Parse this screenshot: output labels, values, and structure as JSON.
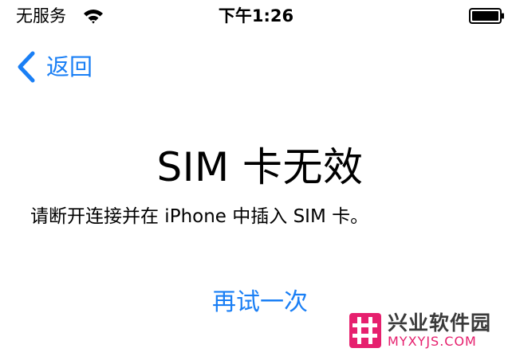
{
  "status_bar": {
    "carrier": "无服务",
    "time": "下午1:26",
    "wifi_icon": "wifi-icon",
    "battery_icon": "battery-full-icon"
  },
  "nav": {
    "back_label": "返回",
    "back_icon": "chevron-left-icon"
  },
  "content": {
    "title": "SIM 卡无效",
    "instruction": "请断开连接并在 iPhone 中插入 SIM 卡。",
    "retry_label": "再试一次"
  },
  "watermark": {
    "name": "兴业软件园",
    "url": "MYXYJS.COM",
    "icon": "hash-logo-icon"
  },
  "colors": {
    "accent": "#1a7ff5",
    "watermark_brand": "#e6206e",
    "background": "#ffffff",
    "text": "#000000"
  }
}
